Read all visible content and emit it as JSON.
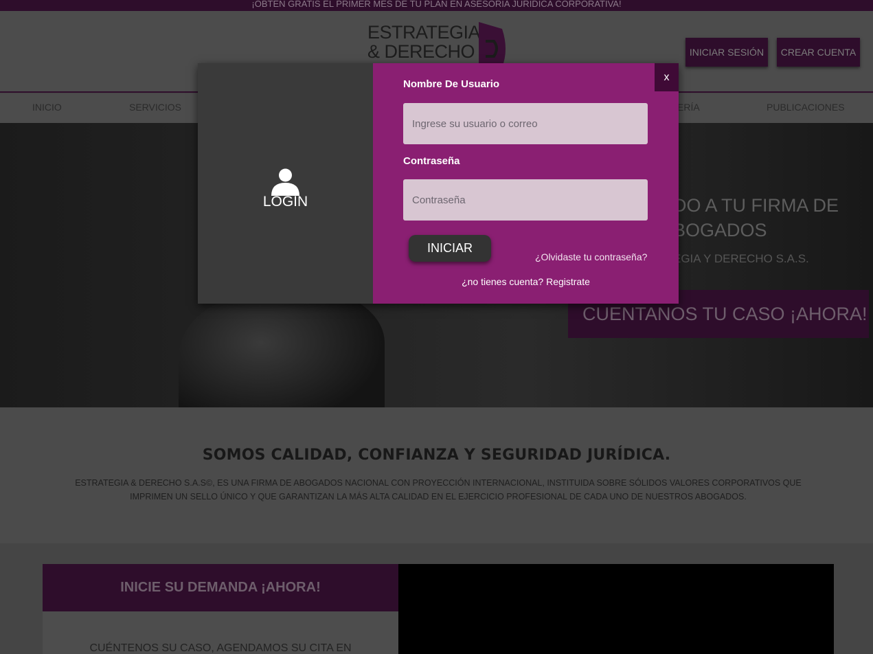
{
  "topbar": {
    "text": "¡OBTEN GRATIS EL PRIMER MES DE TU PLAN EN ASESORIA JURIDICA CORPORATIVA!"
  },
  "logo": {
    "line1": "ESTRATEGIA",
    "line2": "& DERECHO"
  },
  "header": {
    "login_label": "INICIAR SESIÓN",
    "create_label": "CREAR CUENTA"
  },
  "nav": {
    "items": [
      {
        "label": "INICIO"
      },
      {
        "label": "SERVICIOS"
      },
      {
        "label": "ERÍA"
      },
      {
        "label": "PUBLICACIONES"
      }
    ]
  },
  "hero": {
    "title_line1": "DO A TU FIRMA DE",
    "title_line2": "BOGADOS",
    "subtitle": "EGIA Y DERECHO S.A.S.",
    "cta": "CUENTANOS TU CASO ¡AHORA!"
  },
  "about": {
    "heading": "SOMOS CALIDAD, CONFIANZA Y SEGURIDAD JURÍDICA.",
    "text": "ESTRATEGIA & DERECHO S.A.S©, ES UNA FIRMA DE ABOGADOS NACIONAL CON PROYECCIÓN INTERNACIONAL, INSTITUIDA SOBRE SÓLIDOS VALORES CORPORATIVOS QUE IMPRIMEN UN SELLO ÚNICO Y QUE GARANTIZAN LA MÁS ALTA CALIDAD EN EL EJERCICIO PROFESIONAL DE CADA UNO DE NUESTROS ABOGADOS."
  },
  "demand": {
    "heading": "INICIE SU DEMANDA ¡AHORA!",
    "text": "CUÉNTENOS SU CASO, AGENDAMOS SU CITA EN"
  },
  "modal": {
    "login_title": "LOGIN",
    "close_label": "x",
    "username_label": "Nombre De Usuario",
    "username_placeholder": "Ingrese su usuario o correo",
    "password_label": "Contraseña",
    "password_placeholder": "Contraseña",
    "submit_label": "INICIAR",
    "forgot_label": "¿Olvidaste tu contraseña?",
    "no_account_text": "¿no tienes cuenta?",
    "register_label": "Registrate"
  },
  "colors": {
    "brand_dark": "#2e0d2b",
    "modal_accent": "#8a1f72",
    "input_bg": "#d8c6d2"
  }
}
